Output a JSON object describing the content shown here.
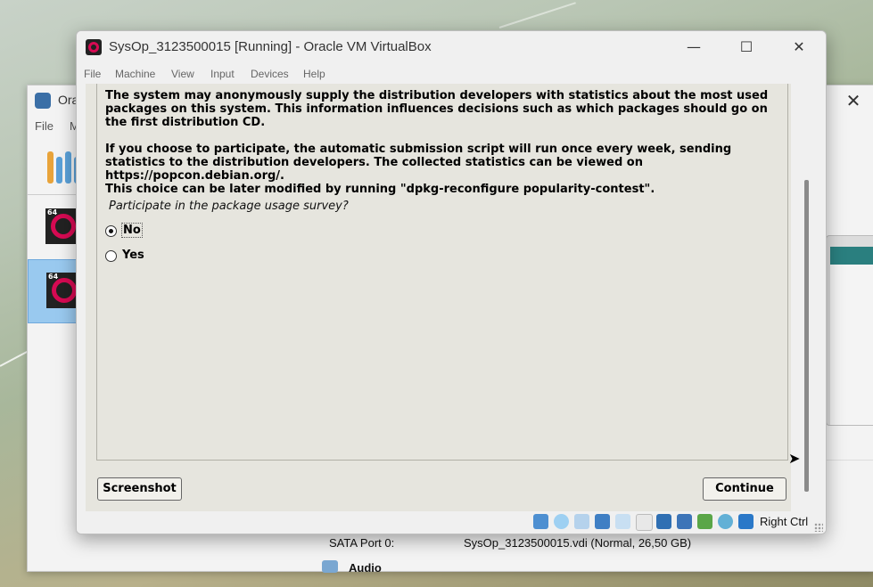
{
  "background_window": {
    "title": "Ora",
    "menu": [
      "File",
      "M"
    ],
    "storage": {
      "sata_label": "SATA Port 0:",
      "sata_value": "SysOp_3123500015.vdi (Normal, 26,50 GB)"
    },
    "audio_label": "Audio",
    "vm_badges": [
      "64",
      "64"
    ]
  },
  "vm_window": {
    "title": "SysOp_3123500015 [Running] - Oracle VM VirtualBox",
    "menu": {
      "file": "File",
      "machine": "Machine",
      "view": "View",
      "input": "Input",
      "devices": "Devices",
      "help": "Help"
    },
    "host_key": "Right Ctrl"
  },
  "installer": {
    "paragraph1": "The system may anonymously supply the distribution developers with statistics about the most used packages on this system. This information influences decisions such as which packages should go on the first distribution CD.",
    "paragraph2": "If you choose to participate, the automatic submission script will run once every week, sending statistics to the distribution developers. The collected statistics can be viewed on https://popcon.debian.org/.",
    "paragraph3": "This choice can be later modified by running \"dpkg-reconfigure popularity-contest\".",
    "question": "Participate in the package usage survey?",
    "options": [
      {
        "label": "No",
        "selected": true
      },
      {
        "label": "Yes",
        "selected": false
      }
    ],
    "screenshot_button": "Screenshot",
    "continue_button": "Continue"
  },
  "status_icons": [
    "hard-disk-icon",
    "optical-drive-icon",
    "audio-icon",
    "network-icon",
    "usb-icon",
    "shared-folders-icon",
    "display-icon",
    "recording-icon",
    "cpu-icon",
    "mouse-integration-icon",
    "keyboard-capture-icon"
  ]
}
